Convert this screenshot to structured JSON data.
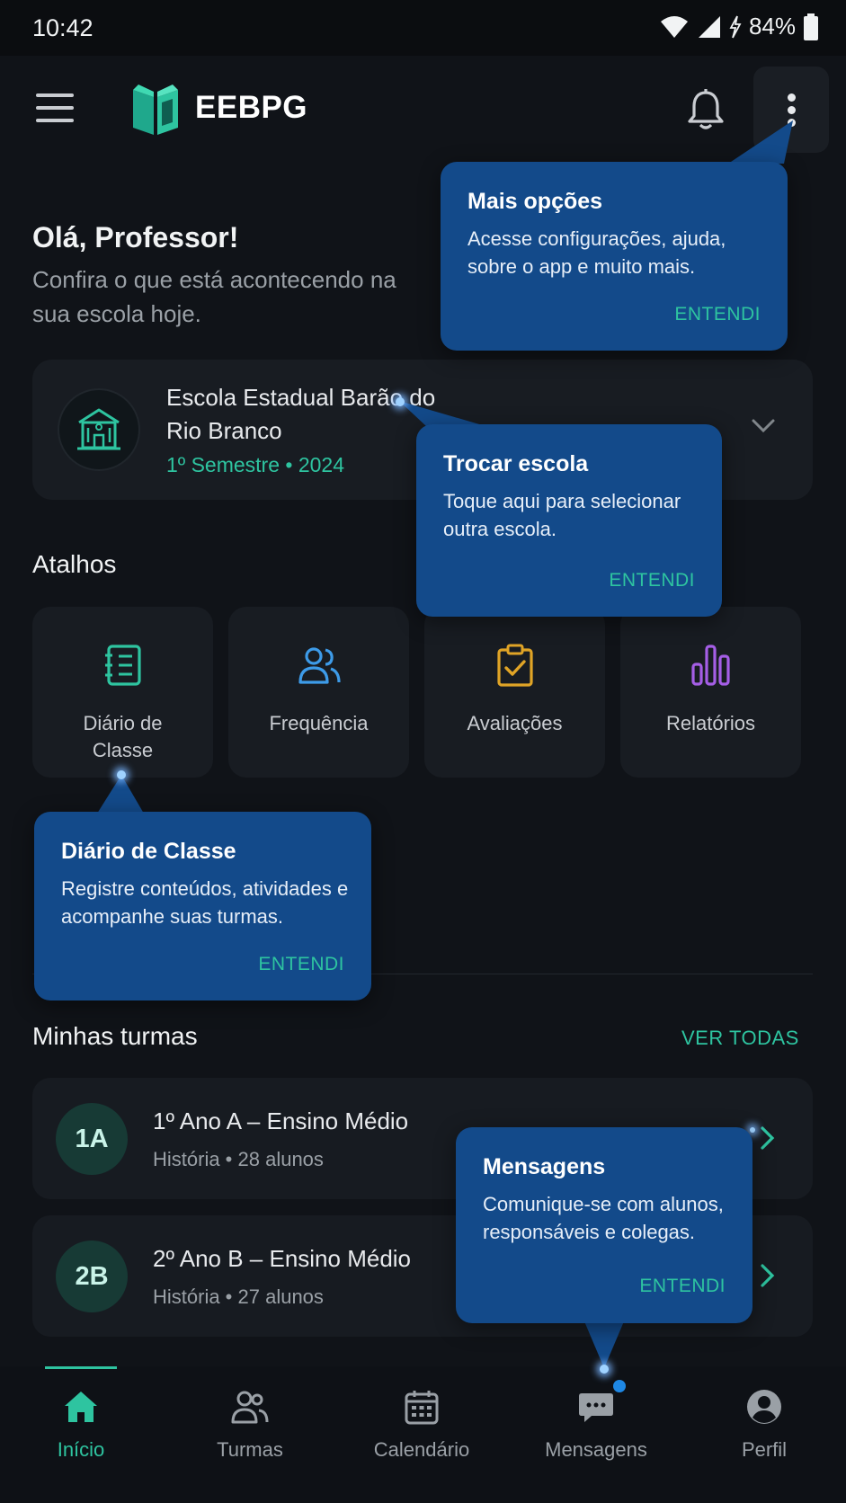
{
  "status_bar": {
    "time": "10:42",
    "battery": "84%"
  },
  "header": {
    "brand": "EEBPG"
  },
  "greeting": {
    "title": "Olá, Professor!",
    "subtitle": "Confira o que está acontecendo na sua escola hoje."
  },
  "school": {
    "name": "Escola Estadual Barão do Rio Branco",
    "semester": "1º Semestre • 2024"
  },
  "shortcuts": {
    "title": "Atalhos",
    "items": [
      {
        "label": "Diário de Classe",
        "icon": "notebook-icon",
        "color": "#2ec4a0"
      },
      {
        "label": "Frequência",
        "icon": "users-icon",
        "color": "#3d9be9"
      },
      {
        "label": "Avaliações",
        "icon": "clipboard-check-icon",
        "color": "#e0a426"
      },
      {
        "label": "Relatórios",
        "icon": "bar-chart-icon",
        "color": "#a55ee6"
      }
    ]
  },
  "classes": {
    "title": "Minhas turmas",
    "see_all": "VER TODAS",
    "items": [
      {
        "code": "1A",
        "name": "1º Ano A – Ensino Médio",
        "detail": "História • 28 alunos"
      },
      {
        "code": "2B",
        "name": "2º Ano B – Ensino Médio",
        "detail": "História • 27 alunos"
      }
    ]
  },
  "bottom_nav": {
    "items": [
      {
        "label": "Início",
        "icon": "home-icon",
        "active": true
      },
      {
        "label": "Turmas",
        "icon": "users-icon",
        "active": false
      },
      {
        "label": "Calendário",
        "icon": "calendar-icon",
        "active": false
      },
      {
        "label": "Mensagens",
        "icon": "chat-icon",
        "active": false
      },
      {
        "label": "Perfil",
        "icon": "profile-icon",
        "active": false
      }
    ]
  },
  "tooltips": {
    "more_options": {
      "title": "Mais opções",
      "body": "Acesse configurações, ajuda, sobre o app e muito mais.",
      "button": "ENTENDI"
    },
    "switch_school": {
      "title": "Trocar escola",
      "body": "Toque aqui para selecionar outra escola.",
      "button": "ENTENDI"
    },
    "class_diary": {
      "title": "Diário de Classe",
      "body": "Registre conteúdos, atividades e acompanhe suas turmas.",
      "button": "ENTENDI"
    },
    "messages": {
      "title": "Mensagens",
      "body": "Comunique-se com alunos, responsáveis e colegas.",
      "button": "ENTENDI"
    }
  },
  "colors": {
    "accent": "#2ec4a0",
    "tooltip": "#134a8a",
    "background": "#101318",
    "card": "#181c22"
  }
}
